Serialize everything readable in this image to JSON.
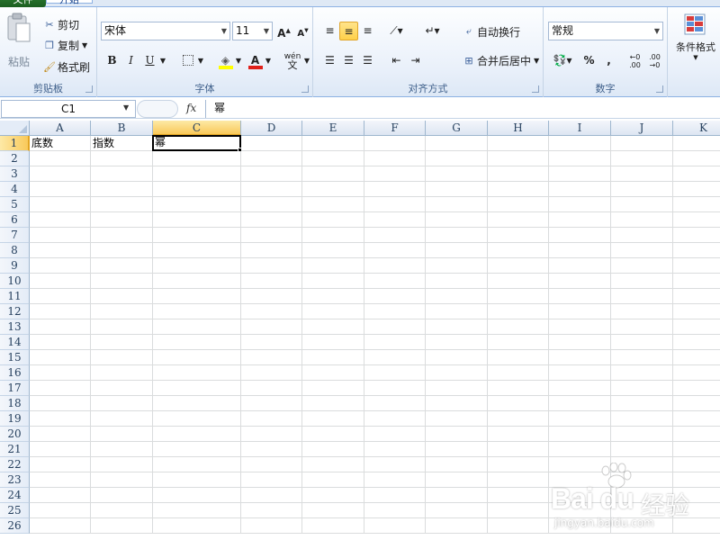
{
  "ribbon": {
    "tabs": {
      "file": "文件",
      "home": "开始"
    },
    "clipboard": {
      "group_label": "剪贴板",
      "paste": "粘贴",
      "cut": "剪切",
      "copy": "复制",
      "format_painter": "格式刷"
    },
    "font": {
      "group_label": "字体",
      "font_name": "宋体",
      "font_size": "11",
      "bold": "B",
      "italic": "I",
      "underline": "U",
      "wen": "wén"
    },
    "alignment": {
      "group_label": "对齐方式",
      "wrap_text": "自动换行",
      "merge_center": "合并后居中"
    },
    "number": {
      "group_label": "数字",
      "format": "常规",
      "percent": "%",
      "comma": ",",
      "inc_decimal": ".00",
      "dec_decimal": ".00"
    },
    "styles": {
      "conditional_format": "条件格式"
    }
  },
  "formula_bar": {
    "name_box": "C1",
    "fx": "fx",
    "content": "幂"
  },
  "grid": {
    "columns": [
      "A",
      "B",
      "C",
      "D",
      "E",
      "F",
      "G",
      "H",
      "I",
      "J",
      "K"
    ],
    "rows": [
      "1",
      "2",
      "3",
      "4",
      "5",
      "6",
      "7",
      "8",
      "9",
      "10",
      "11",
      "12",
      "13",
      "14",
      "15",
      "16",
      "17",
      "18",
      "19",
      "20",
      "21",
      "22",
      "23",
      "24",
      "25",
      "26"
    ],
    "selected_column": "C",
    "selected_row": "1",
    "cells": {
      "A1": "底数",
      "B1": "指数",
      "C1": "幂"
    }
  },
  "watermark": {
    "brand": "Bai  du",
    "cn": "经验",
    "url": "jingyan.baidu.com"
  },
  "colors": {
    "ribbon_bg": "#e9f0fa",
    "selection_header": "#f9c95a",
    "gridline": "#dadcdd",
    "file_tab": "#2e7d32"
  }
}
